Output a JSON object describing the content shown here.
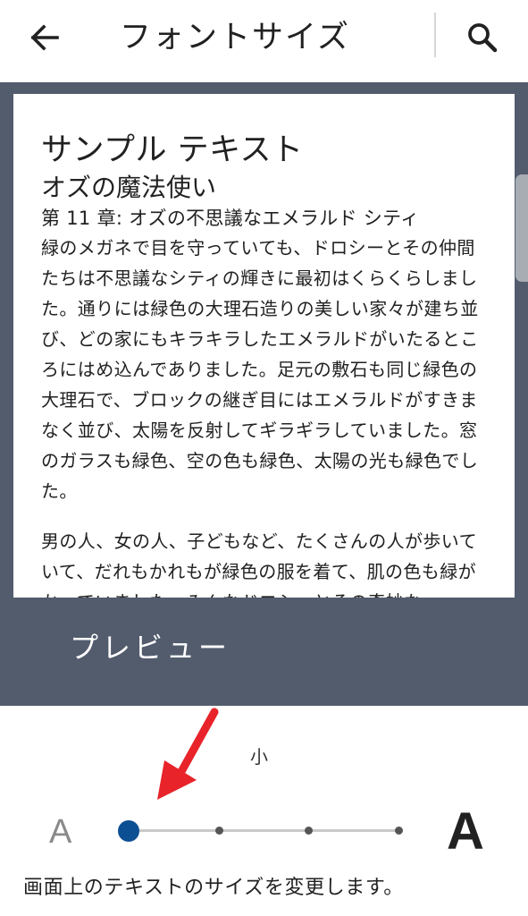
{
  "appbar": {
    "title": "フォントサイズ",
    "back_icon": "arrow-left",
    "search_icon": "magnifier"
  },
  "preview": {
    "heading": "サンプル テキスト",
    "book_title": "オズの魔法使い",
    "chapter_title": "第 11 章: オズの不思議なエメラルド シティ",
    "paragraphs": [
      "緑のメガネで目を守っていても、ドロシーとその仲間たちは不思議なシティの輝きに最初はくらくらしました。通りには緑色の大理石造りの美しい家々が建ち並び、どの家にもキラキラしたエメラルドがいたるところにはめ込んでありました。足元の敷石も同じ緑色の大理石で、ブロックの継ぎ目にはエメラルドがすきまなく並び、太陽を反射してギラギラしていました。窓のガラスも緑色、空の色も緑色、太陽の光も緑色でした。",
      "男の人、女の人、子どもなど、たくさんの人が歩いていて、だれもかれもが緑色の服を着て、肌の色も緑がかっていました。みんなドロシーとその奇妙な"
    ],
    "label": "プレビュー"
  },
  "font_size": {
    "current_label": "小",
    "small_glyph": "A",
    "large_glyph": "A",
    "level": 1,
    "levels": 4,
    "accent_color": "#0d4f93",
    "annotation_color": "#e8232a"
  },
  "description": "画面上のテキストのサイズを変更します。"
}
